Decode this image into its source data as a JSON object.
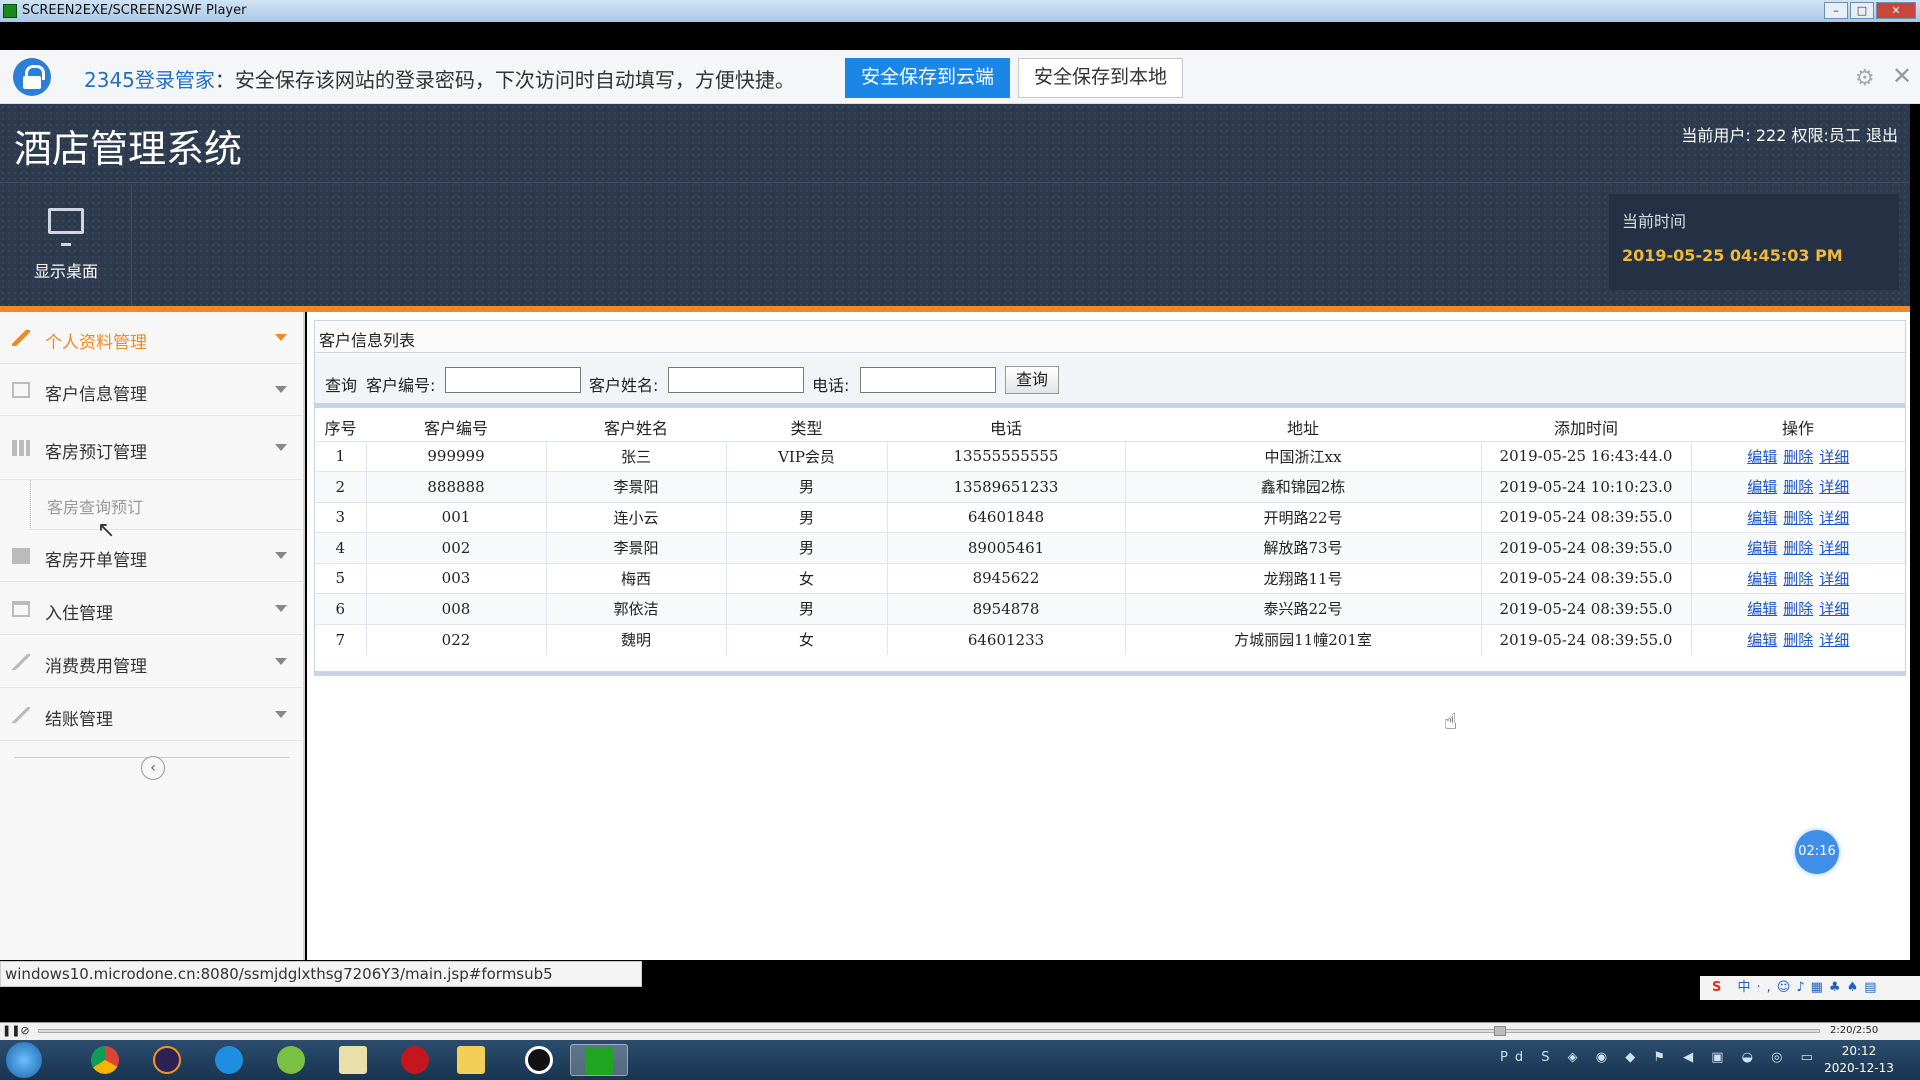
{
  "window": {
    "title": "SCREEN2EXE/SCREEN2SWF Player"
  },
  "password_bar": {
    "brand": "2345登录管家",
    "message": "：安全保存该网站的登录密码，下次访问时自动填写，方便快捷。",
    "save_cloud": "安全保存到云端",
    "save_local": "安全保存到本地"
  },
  "header": {
    "app_title": "酒店管理系统",
    "current_user_label": "当前用户:",
    "current_user": "222",
    "role_label": "权限:",
    "role": "员工",
    "logout": "退出",
    "show_desktop": "显示桌面",
    "time_label": "当前时间",
    "time_value": "2019-05-25 04:45:03 PM"
  },
  "sidebar": {
    "items": [
      {
        "label": "个人资料管理",
        "active": true
      },
      {
        "label": "客户信息管理"
      },
      {
        "label": "客房预订管理"
      },
      {
        "label": "客房查询预订",
        "sub": true
      },
      {
        "label": "客房开单管理"
      },
      {
        "label": "入住管理"
      },
      {
        "label": "消费费用管理"
      },
      {
        "label": "结账管理"
      }
    ]
  },
  "panel": {
    "title": "客户信息列表",
    "search": {
      "prefix": "查询",
      "customer_id_label": "客户编号:",
      "customer_name_label": "客户姓名:",
      "phone_label": "电话:",
      "button": "查询"
    },
    "columns": [
      "序号",
      "客户编号",
      "客户姓名",
      "类型",
      "电话",
      "地址",
      "添加时间",
      "操作"
    ],
    "rows": [
      [
        "1",
        "999999",
        "张三",
        "VIP会员",
        "13555555555",
        "中国浙江xx",
        "2019-05-25 16:43:44.0"
      ],
      [
        "2",
        "888888",
        "李景阳",
        "男",
        "13589651233",
        "鑫和锦园2栋",
        "2019-05-24 10:10:23.0"
      ],
      [
        "3",
        "001",
        "连小云",
        "男",
        "64601848",
        "开明路22号",
        "2019-05-24 08:39:55.0"
      ],
      [
        "4",
        "002",
        "李景阳",
        "男",
        "89005461",
        "解放路73号",
        "2019-05-24 08:39:55.0"
      ],
      [
        "5",
        "003",
        "梅西",
        "女",
        "8945622",
        "龙翔路11号",
        "2019-05-24 08:39:55.0"
      ],
      [
        "6",
        "008",
        "郭依洁",
        "男",
        "8954878",
        "泰兴路22号",
        "2019-05-24 08:39:55.0"
      ],
      [
        "7",
        "022",
        "魏明",
        "女",
        "64601233",
        "方城丽园11幢201室",
        "2019-05-24 08:39:55.0"
      ]
    ],
    "actions": [
      "编辑",
      "删除",
      "详细"
    ]
  },
  "timer": "02:16",
  "status_url": "windows10.microdone.cn:8080/ssmjdglxthsg7206Y3/main.jsp#formsub5",
  "ime": {
    "logo": "S",
    "text": "中·,☺♪▦♣♠▤"
  },
  "player": {
    "time": "2:20/2:50"
  },
  "taskbar": {
    "clock_time": "20:12",
    "clock_date": "2020-12-13"
  },
  "colors": {
    "accent": "#f08a24",
    "header_bg": "#2e3b4e",
    "link": "#1c55c9",
    "time": "#f0b83a"
  }
}
